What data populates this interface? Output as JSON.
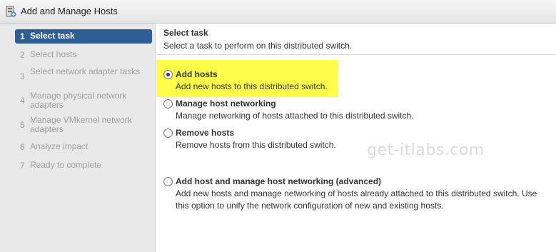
{
  "window": {
    "title": "Add and Manage Hosts",
    "icon": "add-hosts-wizard-icon"
  },
  "sidebar": {
    "steps": [
      {
        "num": "1",
        "label": "Select task",
        "active": true
      },
      {
        "num": "2",
        "label": "Select hosts"
      },
      {
        "num": "3",
        "label": "Select network adapter tasks"
      },
      {
        "num": "4",
        "label": "Manage physical network adapters"
      },
      {
        "num": "5",
        "label": "Manage VMkernel network adapters"
      },
      {
        "num": "6",
        "label": "Analyze impact"
      },
      {
        "num": "7",
        "label": "Ready to complete"
      }
    ]
  },
  "main": {
    "title": "Select task",
    "subtitle": "Select a task to perform on this distributed switch.",
    "options": [
      {
        "label": "Add hosts",
        "desc": "Add new hosts to this distributed switch.",
        "selected": true
      },
      {
        "label": "Manage host networking",
        "desc": "Manage networking of hosts attached to this distributed switch."
      },
      {
        "label": "Remove hosts",
        "desc": "Remove hosts from this distributed switch."
      },
      {
        "label": "Add host and manage host networking (advanced)",
        "desc": "Add new hosts and manage networking of hosts already attached to this distributed switch. Use this option to unify the network configuration of new and existing hosts."
      }
    ]
  },
  "watermark": "get-itlabs.com",
  "colors": {
    "active_step": "#2d5e95",
    "highlight": "#fdfd4a",
    "sidebar_bg": "#e9e9e9"
  }
}
